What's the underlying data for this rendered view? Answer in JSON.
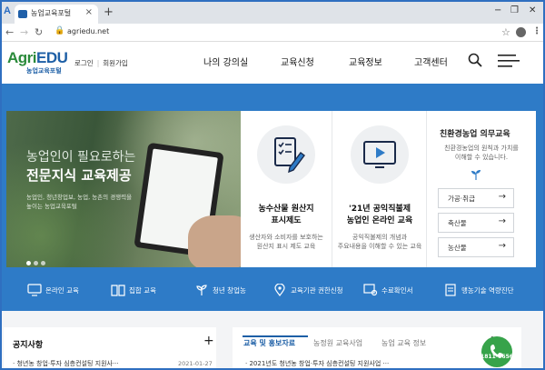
{
  "browser": {
    "tab_title": "농업교육포털",
    "tab_close": "×",
    "new_tab": "+",
    "url": "agriedu.net",
    "win_min": "−",
    "win_max": "❐",
    "win_close": "✕"
  },
  "header": {
    "logo_agri": "Agri",
    "logo_edu": "EDU",
    "logo_sub": "농업교육포털",
    "login": "로그인",
    "separator": "|",
    "signup": "회원가입",
    "nav": [
      "나의 강의실",
      "교육신청",
      "교육정보",
      "고객센터"
    ]
  },
  "hero": {
    "title_line1": "농업인이 필요로하는",
    "title_line2": "전문지식 교육제공",
    "desc_line1": "농업인, 청년창업보, 농업, 농촌의 경쟁력을",
    "desc_line2": "높이는 농업교육포털"
  },
  "cards": [
    {
      "title_line1": "농수산물 원산지",
      "title_line2": "표시제도",
      "desc_line1": "생산자와 소비자를 보호하는",
      "desc_line2": "원산지 표시 제도 교육"
    },
    {
      "title_line1": "'21년 공익직불제",
      "title_line2": "농업인 온라인 교육",
      "desc_line1": "공익직불제의 개념과",
      "desc_line2": "주요내용을 이해할 수 있는 교육"
    }
  ],
  "eco": {
    "title": "친환경농업 의무교육",
    "desc_line1": "친환경농업의 원칙과 가치를",
    "desc_line2": "이해할 수 있습니다.",
    "buttons": [
      "가공·취급",
      "축산물",
      "농산물"
    ],
    "arrow": "→"
  },
  "quick_menu": [
    "온라인 교육",
    "집합 교육",
    "청년 창업농",
    "교육기관 권한신청",
    "수료확인서",
    "맹농기술 역량진단"
  ],
  "notice": {
    "title": "공지사항",
    "plus": "+",
    "item": "청년농 창업·투자 심층컨설팅 지원사···",
    "date": "2021-01-27"
  },
  "news": {
    "tabs": [
      "교육 및 홍보자료",
      "농정원 교육사업",
      "농업 교육 정보"
    ],
    "plus": "+",
    "item": "2021년도 청년농 창업·투자 심층컨설팅 지원사업 ···",
    "side": "1811-"
  },
  "call": {
    "number": "1811-8656"
  }
}
